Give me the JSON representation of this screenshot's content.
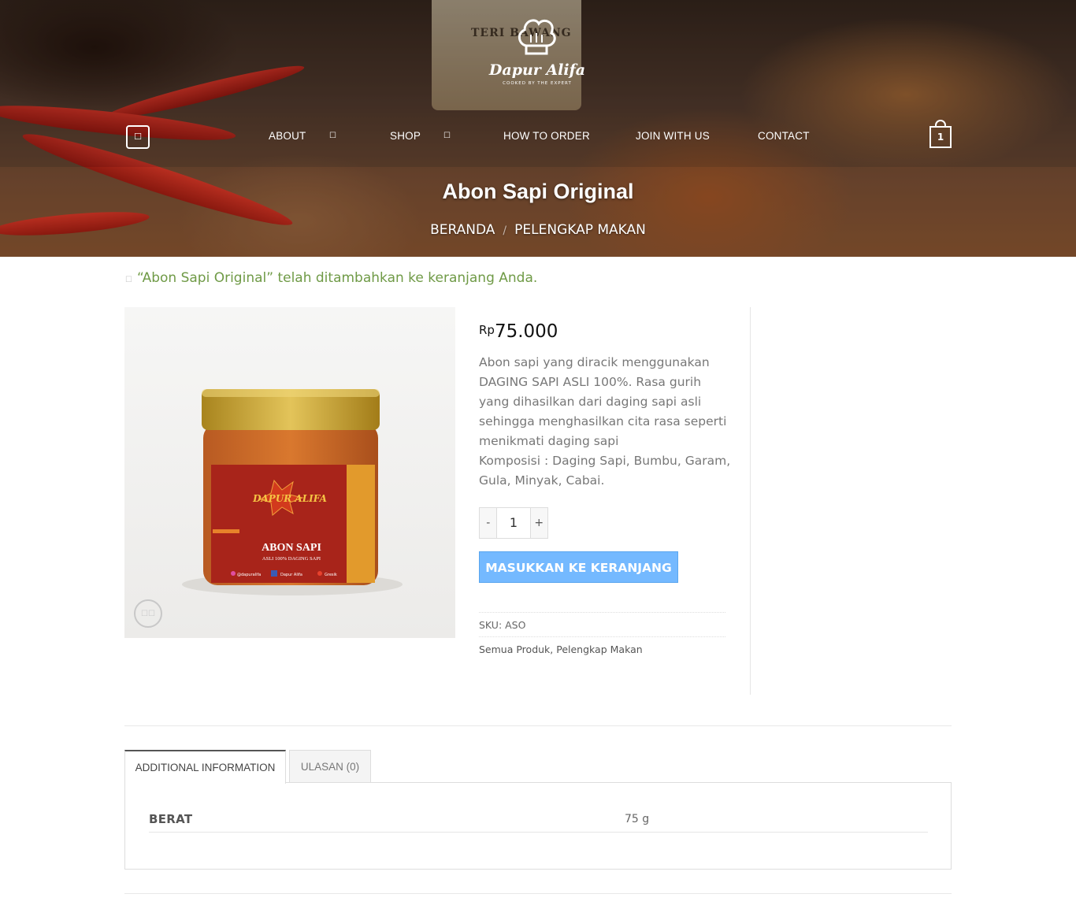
{
  "site": {
    "logo_name": "Dapur Alifa",
    "logo_tagline": "COOKED BY THE EXPERT",
    "hero_jar_text": "TERI BAWANG"
  },
  "nav": {
    "menu_icon": "menu-icon",
    "items": [
      {
        "label": "ABOUT",
        "has_dropdown": true
      },
      {
        "label": "SHOP",
        "has_dropdown": true
      },
      {
        "label": "HOW TO ORDER",
        "has_dropdown": false
      },
      {
        "label": "JOIN WITH US",
        "has_dropdown": false
      },
      {
        "label": "CONTACT",
        "has_dropdown": false
      }
    ],
    "cart_count": "1"
  },
  "page": {
    "title": "Abon Sapi Original",
    "breadcrumb": [
      "BERANDA",
      "PELENGKAP MAKAN"
    ],
    "breadcrumb_sep": "/"
  },
  "notice": {
    "text": "“Abon Sapi Original” telah ditambahkan ke keranjang Anda."
  },
  "product": {
    "image_label": {
      "brand": "DAPUR ALIFA",
      "name": "ABON SAPI",
      "sub": "ASLI 100% DAGING SAPI",
      "instagram": "@dapuralifa",
      "facebook": "Dapur Alifa",
      "location": "Gresik"
    },
    "currency": "Rp",
    "price": "75.000",
    "description": [
      "Abon sapi yang diracik menggunakan DAGING SAPI ASLI 100%. Rasa gurih yang dihasilkan dari daging sapi asli sehingga menghasilkan cita rasa seperti menikmati daging sapi",
      "Komposisi : Daging Sapi, Bumbu, Garam, Gula, Minyak, Cabai."
    ],
    "qty_minus": "-",
    "quantity": "1",
    "qty_plus": "+",
    "add_to_cart_label": "MASUKKAN KE KERANJANG",
    "sku": "SKU: ASO",
    "categories": "Semua Produk, Pelengkap Makan"
  },
  "tabs": {
    "items": [
      {
        "label": "ADDITIONAL INFORMATION",
        "active": true
      },
      {
        "label": "ULASAN (0)",
        "active": false
      }
    ],
    "attributes": [
      {
        "label": "BERAT",
        "value": "75 g"
      }
    ]
  },
  "colors": {
    "accent_button": "#74b9ff",
    "notice_text": "#6f9a46",
    "price_text": "#111111"
  }
}
